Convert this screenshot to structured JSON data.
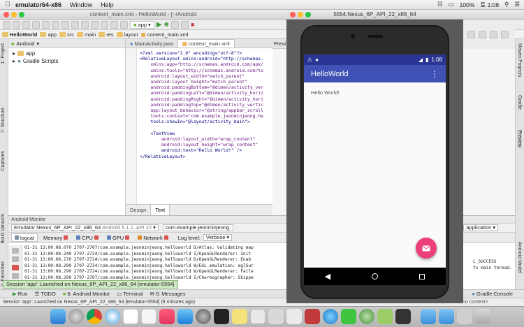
{
  "menubar": {
    "apple": "",
    "app_name": "emulator64-x86",
    "items": [
      "Window",
      "Help"
    ],
    "battery": "100%",
    "day_time": "토 1:08"
  },
  "studio": {
    "window_title": "content_main.xml - HelloWorld - [~/Android",
    "toolbar": {
      "run_config": "app"
    },
    "breadcrumbs": [
      "HelloWorld",
      "app",
      "src",
      "main",
      "res",
      "layout",
      "content_main.xml"
    ],
    "project_panel": {
      "view_selector": "Android",
      "tree": [
        "app",
        "Gradle Scripts"
      ]
    },
    "editor_tabs": [
      "MainActivity.java",
      "content_main.xml"
    ],
    "preview_tab": "Previ",
    "code_lines": [
      "<?xml version=\"1.0\" encoding=\"utf-8\"?>",
      "<RelativeLayout xmlns:android=\"http://schemas.",
      "    xmlns:app=\"http://schemas.android.com/apk/",
      "    xmlns:tools=\"http://schemas.android.com/to",
      "    android:layout_width=\"match_parent\"",
      "    android:layout_height=\"match_parent\"",
      "    android:paddingBottom=\"@dimen/activity_ver",
      "    android:paddingLeft=\"@dimen/activity_horiz",
      "    android:paddingRight=\"@dimen/activity_hori",
      "    android:paddingTop=\"@dimen/activity_vertic",
      "    app:layout_behavior=\"@string/appbar_scroll",
      "    tools:context=\"com.example.jeonminjeong.he",
      "    tools:showIn=\"@layout/activity_main\">",
      "",
      "    <TextView",
      "        android:layout_width=\"wrap_content\"",
      "        android:layout_height=\"wrap_content\"",
      "        android:text=\"Hello World!\" />",
      "</RelativeLayout>"
    ],
    "editor_bottom_tabs": [
      "Design",
      "Text"
    ],
    "monitor": {
      "title": "Android Monitor",
      "device": "Emulator Nexus_6P_API_22_x86_64",
      "device_detail": "Android 5.1.1, API 22",
      "process": "com.example.jeonminjeong.",
      "tabs": [
        "logcat",
        "Memory",
        "CPU",
        "GPU",
        "Network"
      ],
      "log_level_label": "Log level:",
      "log_level": "Verbose",
      "filter": "application",
      "log_lines": [
        "01-31 13:00:08.070 2707-2707/com.example.jeonminjeong.helloworld D/Atlas: Validating map",
        "01-31 13:00:08.240 2707-2724/com.example.jeonminjeong.helloworld I/OpenGLRenderer: Init",
        "01-31 13:00:08.270 2707-2724/com.example.jeonminjeong.helloworld D/OpenGLRenderer: Enab",
        "01-31 13:00:08.290 2707-2724/com.example.jeonminjeong.helloworld W/EGL_emulation: eglSur",
        "01-31 13:00:08.290 2707-2724/com.example.jeonminjeong.helloworld W/OpenGLRenderer: Faile",
        "01-31 13:00:08.290 2707-2707/com.example.jeonminjeong.helloworld I/Choreographer: Skippe"
      ],
      "log_tail": [
        "L_SUCCESS",
        "ts main thread."
      ]
    },
    "bottom_tabs": [
      "Run",
      "TODO",
      "6: Android Monitor",
      "Terminal",
      "0: Messages",
      "Gradle Console"
    ],
    "launch_balloon": "Session 'app': Launched on Nexus_6P_API_22_x86_64 [emulator-5554]",
    "status_text": "Session 'app': Launched on Nexus_6P_API_22_x86_64 [emulator-5554] (8 minutes ago)",
    "status_right": "<no context>",
    "left_tool_windows": [
      "1: Project",
      "7: Structure",
      "Captures",
      "Build Variants",
      "2: Favorites"
    ],
    "right_tool_windows": [
      "Maven Projects",
      "Gradle",
      "Preview",
      "Android Model"
    ]
  },
  "emulator": {
    "window_title": "5554:Nexus_6P_API_22_x86_64",
    "status_time": "1:08",
    "app_title": "HelloWorld",
    "content_text": "Hello World!"
  },
  "colors": {
    "primary": "#3f51b5",
    "primary_dark": "#283593",
    "accent": "#ec407a"
  }
}
